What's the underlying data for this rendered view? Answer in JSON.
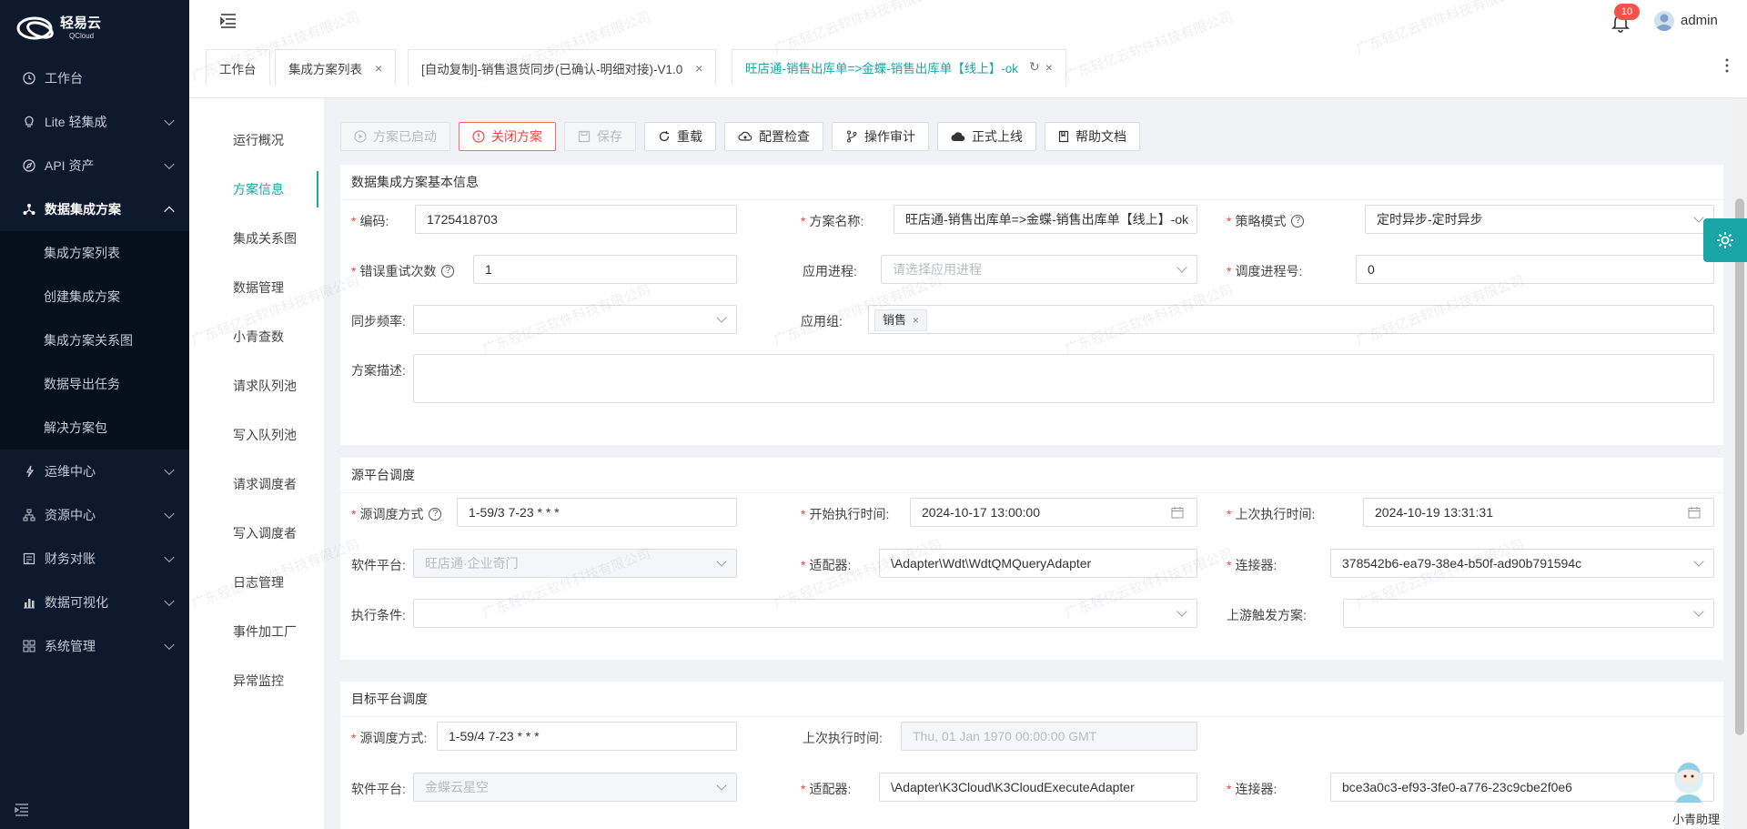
{
  "brand": {
    "name": "轻易云",
    "sub": "QCloud"
  },
  "sidebar": {
    "items": [
      {
        "label": "工作台",
        "icon": "clock-icon"
      },
      {
        "label": "Lite 轻集成",
        "icon": "lightbulb-icon"
      },
      {
        "label": "API 资产",
        "icon": "compass-icon"
      },
      {
        "label": "数据集成方案",
        "icon": "network-icon"
      },
      {
        "label": "运维中心",
        "icon": "wrench-icon"
      },
      {
        "label": "资源中心",
        "icon": "hierarchy-icon"
      },
      {
        "label": "财务对账",
        "icon": "ledger-icon"
      },
      {
        "label": "数据可视化",
        "icon": "bar-chart-icon"
      },
      {
        "label": "系统管理",
        "icon": "grid-icon"
      }
    ],
    "submenu": [
      "集成方案列表",
      "创建集成方案",
      "集成方案关系图",
      "数据导出任务",
      "解决方案包"
    ]
  },
  "header": {
    "notifications": "10",
    "user": "admin"
  },
  "tabs": [
    {
      "label": "工作台"
    },
    {
      "label": "集成方案列表"
    },
    {
      "label": "[自动复制]-销售退货同步(已确认-明细对接)-V1.0"
    },
    {
      "label": "旺店通-销售出库单=>金蝶-销售出库单【线上】-ok"
    }
  ],
  "subnav": [
    "运行概况",
    "方案信息",
    "集成关系图",
    "数据管理",
    "小青查数",
    "请求队列池",
    "写入队列池",
    "请求调度者",
    "写入调度者",
    "日志管理",
    "事件加工厂",
    "异常监控"
  ],
  "toolbar": {
    "started": "方案已启动",
    "close": "关闭方案",
    "save": "保存",
    "reload": "重载",
    "config_check": "配置检查",
    "audit": "操作审计",
    "go_live": "正式上线",
    "help": "帮助文档"
  },
  "basic": {
    "title": "数据集成方案基本信息",
    "code_label": "编码:",
    "code": "1725418703",
    "name_label": "方案名称:",
    "name": "旺店通-销售出库单=>金蝶-销售出库单【线上】-ok",
    "strategy_label": "策略模式",
    "strategy": "定时异步-定时异步",
    "retry_label": "错误重试次数",
    "retry": "1",
    "process_label": "应用进程:",
    "process_placeholder": "请选择应用进程",
    "dispatch_label": "调度进程号:",
    "dispatch": "0",
    "freq_label": "同步频率:",
    "group_label": "应用组:",
    "group_tag": "销售",
    "desc_label": "方案描述:"
  },
  "source": {
    "title": "源平台调度",
    "mode_label": "源调度方式",
    "mode": "1-59/3 7-23 * * *",
    "start_label": "开始执行时间:",
    "start": "2024-10-17 13:00:00",
    "last_label": "上次执行时间:",
    "last": "2024-10-19 13:31:31",
    "platform_label": "软件平台:",
    "platform": "旺店通·企业奇门",
    "adapter_label": "适配器:",
    "adapter": "\\Adapter\\Wdt\\WdtQMQueryAdapter",
    "connector_label": "连接器:",
    "connector": "378542b6-ea79-38e4-b50f-ad90b791594c",
    "cond_label": "执行条件:",
    "upstream_label": "上游触发方案:"
  },
  "target": {
    "title": "目标平台调度",
    "mode_label": "源调度方式:",
    "mode": "1-59/4 7-23 * * *",
    "last_label": "上次执行时间:",
    "last": "Thu, 01 Jan 1970 00:00:00 GMT",
    "platform_label": "软件平台:",
    "platform": "金蝶云星空",
    "adapter_label": "适配器:",
    "adapter": "\\Adapter\\K3Cloud\\K3CloudExecuteAdapter",
    "connector_label": "连接器:",
    "connector": "bce3a0c3-ef93-3fe0-a776-23c9cbe2f0e6"
  },
  "assistant": "小青助理",
  "watermark": "广东轻亿云软件科技有限公司",
  "colors": {
    "accent": "#1aa6a6",
    "sidebar": "#0d1a2e",
    "danger": "#f0423d"
  }
}
